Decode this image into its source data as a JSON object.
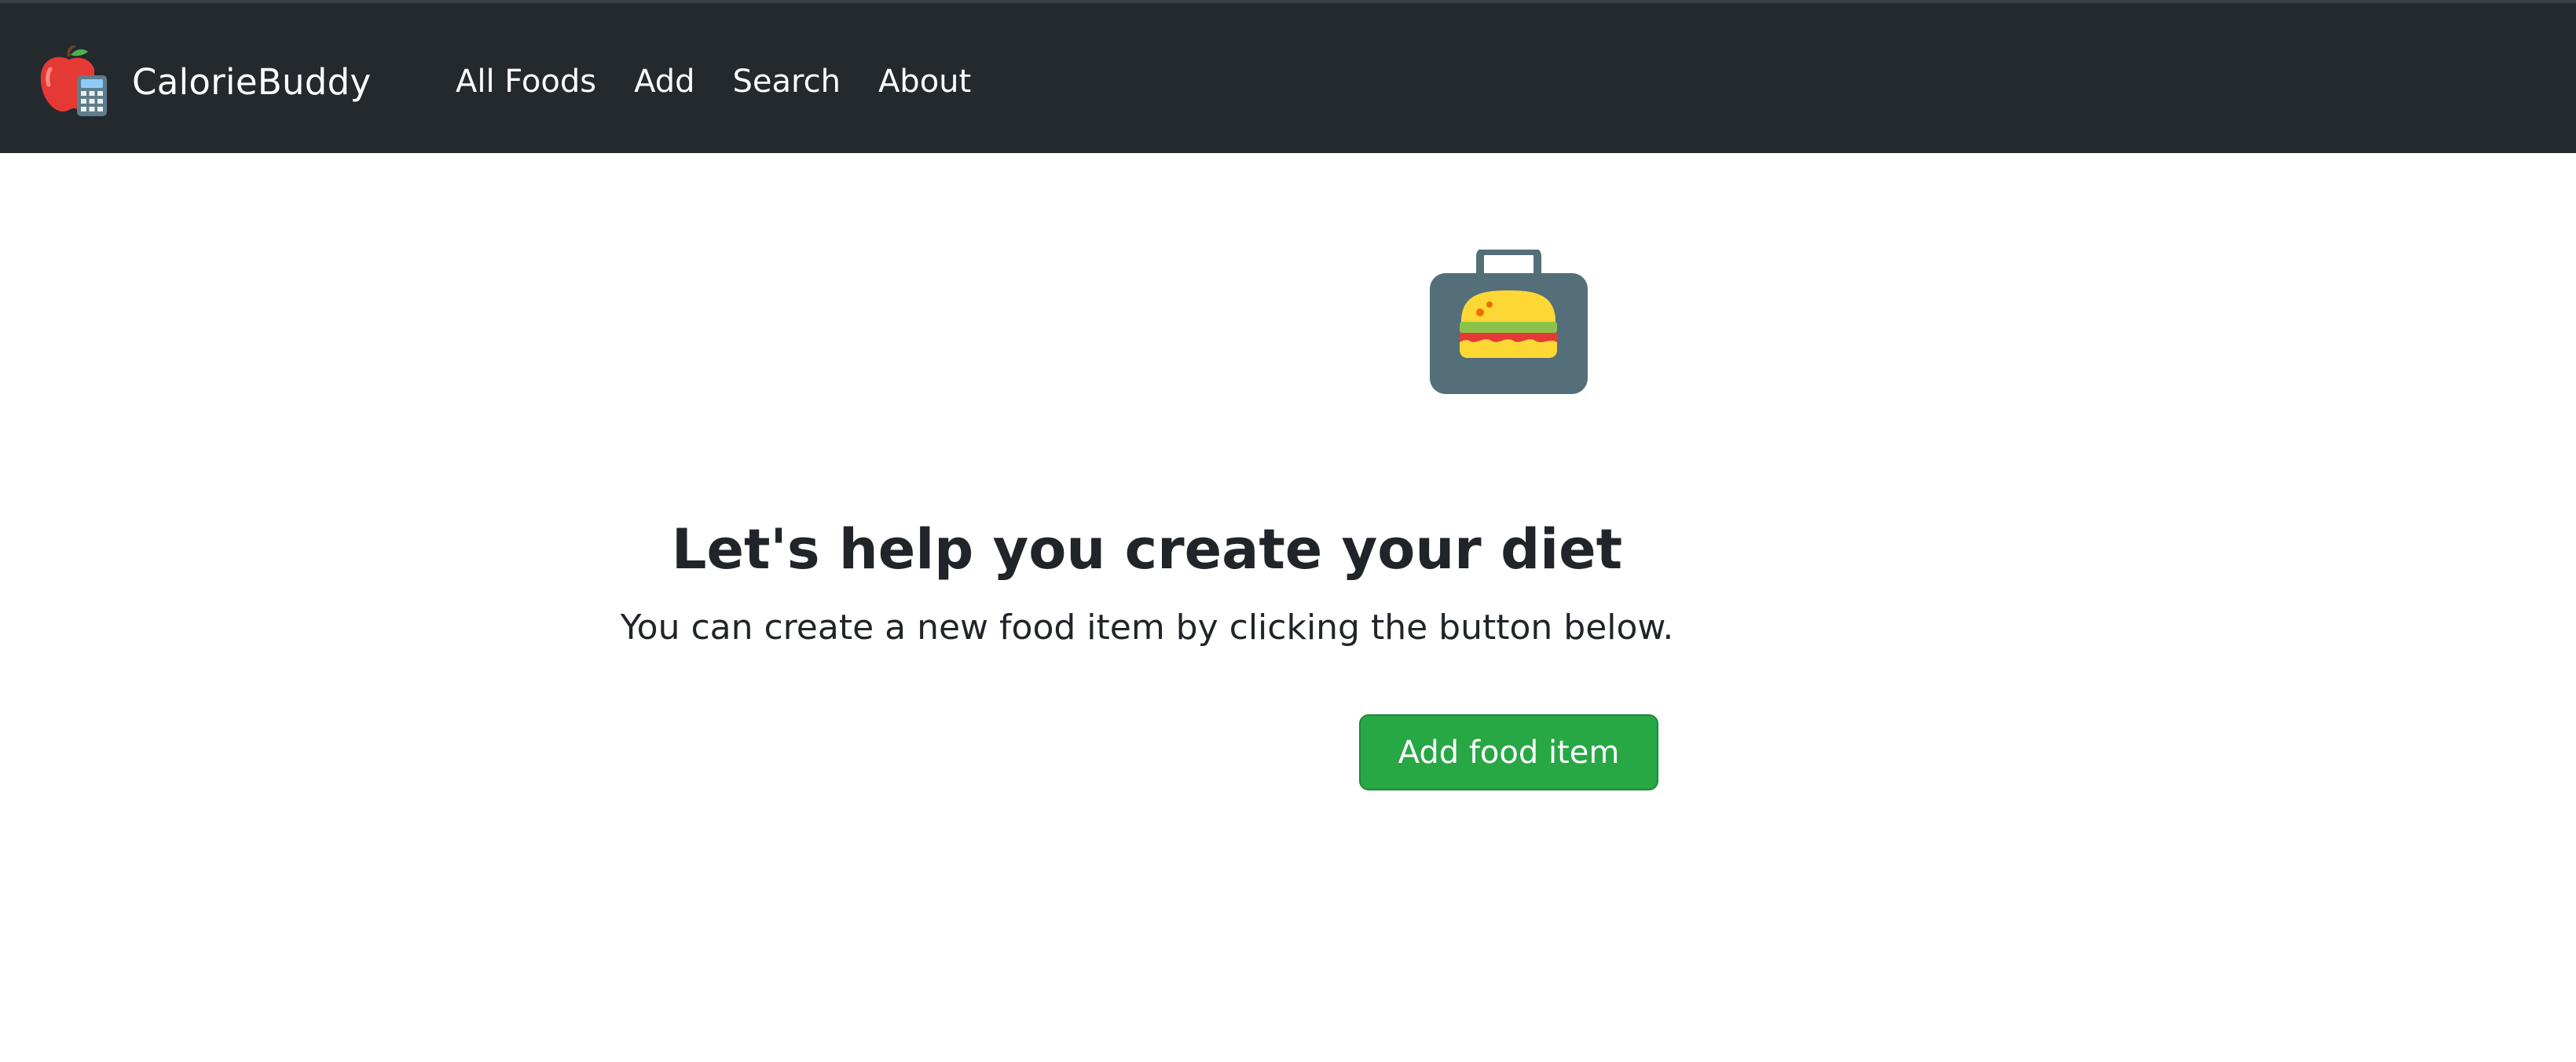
{
  "navbar": {
    "brand_name": "CalorieBuddy",
    "brand_logo_icon": "apple-calculator-icon",
    "links": [
      {
        "label": "All Foods"
      },
      {
        "label": "Add"
      },
      {
        "label": "Search"
      },
      {
        "label": "About"
      }
    ],
    "background_color": "#24292e"
  },
  "main": {
    "hero_icon": "lunchbox-burger-icon",
    "title": "Let's help you create your diet",
    "subtitle": "You can create a new food item by clicking the button below.",
    "button_label": "Add food item",
    "button_color": "#28a745"
  }
}
